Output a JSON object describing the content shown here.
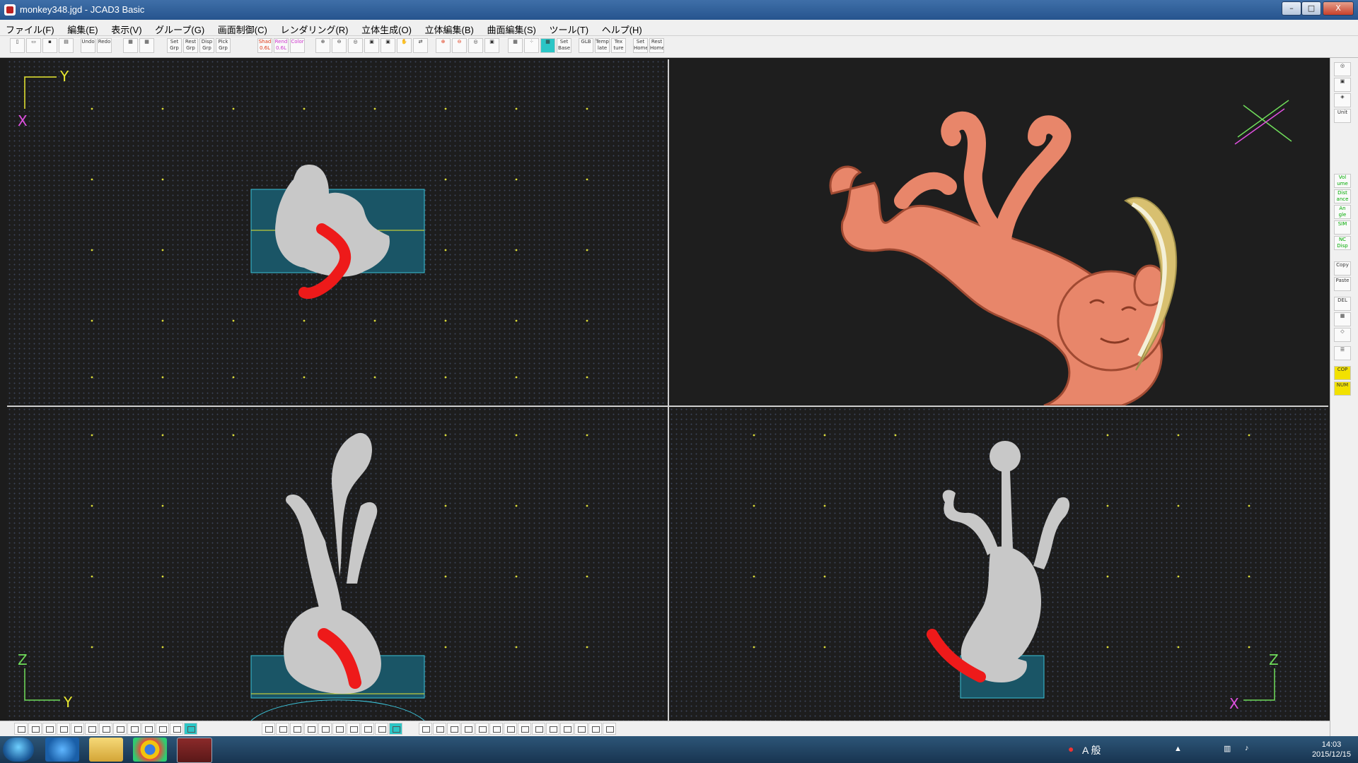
{
  "window": {
    "title": "monkey348.jgd - JCAD3 Basic",
    "buttons": {
      "minimize": "–",
      "maximize": "□",
      "close": "X"
    }
  },
  "menu": [
    "ファイル(F)",
    "編集(E)",
    "表示(V)",
    "グループ(G)",
    "画面制御(C)",
    "レンダリング(R)",
    "立体生成(O)",
    "立体編集(B)",
    "曲面編集(S)",
    "ツール(T)",
    "ヘルプ(H)"
  ],
  "toolbar": {
    "undo": "Undo",
    "redo": "Redo",
    "set_grp": "Set Grp",
    "rest_grp": "Rest Grp",
    "disp_grp": "Disp Grp",
    "pick_grp": "Pick Grp",
    "shad": "Shad 0.6L",
    "rend": "Rend 0.6L",
    "color": "Color",
    "set_base": "Set Base",
    "glb": "GLB",
    "template": "Temp late",
    "texture": "Tex ture",
    "set_home": "Set Home",
    "rest_home": "Rest Home"
  },
  "viewports": {
    "top_left": {
      "axis_h": "Y",
      "axis_v": "X"
    },
    "bottom_left": {
      "axis_h": "Y",
      "axis_v": "Z"
    },
    "bottom_right": {
      "axis_h": "X",
      "axis_v": "Z"
    }
  },
  "side_panel": {
    "unit": "Unit",
    "volume": "Vol ume",
    "distance": "Dist ance",
    "angle": "An gle",
    "sim": "SIM",
    "nc_disp": "NC Disp",
    "copy": "Copy",
    "paste": "Paste",
    "del": "DEL",
    "cop": "COP",
    "num": "NUM"
  },
  "taskbar": {
    "ime": "A 般",
    "time": "14:03",
    "date": "2015/12/15"
  },
  "colors": {
    "grid_dot": "#3a4456",
    "model_gray": "#c8c8c8",
    "highlight_red": "#ee1a1a",
    "monkey_copper": "#e8866a",
    "banana_gold": "#d8c070",
    "axis_yellow": "#e8e830",
    "axis_green": "#6fdc5a",
    "axis_magenta": "#e050e0"
  }
}
